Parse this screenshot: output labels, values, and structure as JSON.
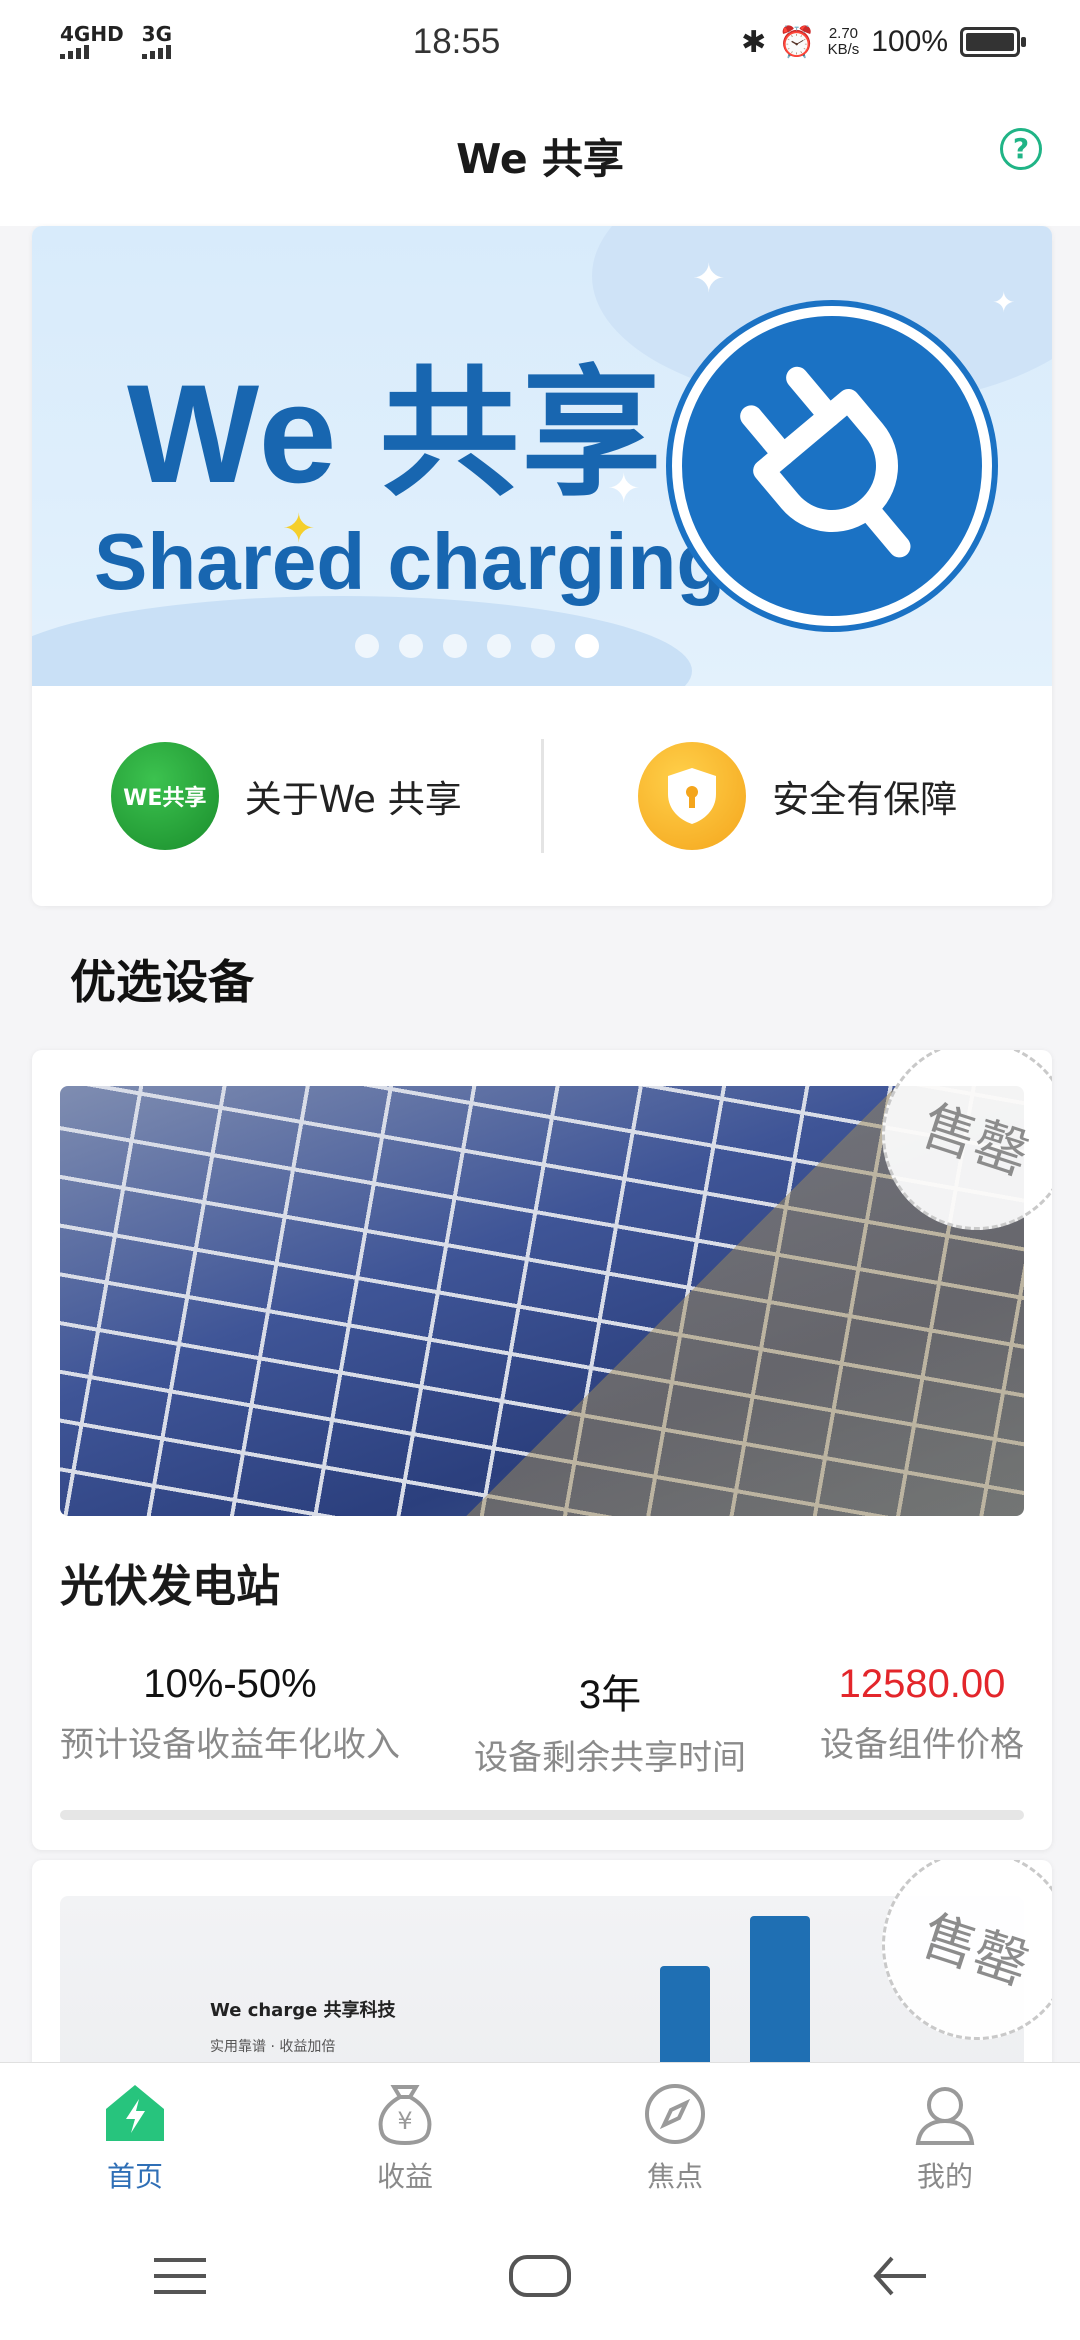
{
  "status_bar": {
    "network1": "4GHD",
    "network2": "3G",
    "time": "18:55",
    "net_speed_value": "2.70",
    "net_speed_unit": "KB/s",
    "battery": "100%"
  },
  "header": {
    "title": "We 共享"
  },
  "banner": {
    "title": "We 共享",
    "subtitle": "Shared charging",
    "slide_count": 6,
    "active_slide": 6
  },
  "quick_links": [
    {
      "label": "关于We 共享",
      "icon": "we-share-logo-icon",
      "icon_text": "WE共享"
    },
    {
      "label": "安全有保障",
      "icon": "shield-icon"
    }
  ],
  "section": {
    "title": "优选设备"
  },
  "products": [
    {
      "title": "光伏发电站",
      "badge": "售罄",
      "stats": [
        {
          "value": "10%-50%",
          "label": "预计设备收益年化收入"
        },
        {
          "value": "3年",
          "label": "设备剩余共享时间"
        },
        {
          "value": "12580.00",
          "label": "设备组件价格"
        }
      ],
      "progress": 0
    },
    {
      "badge": "售罄",
      "image_text_brand": "We charge 共享科技",
      "image_text_sub": "实用靠谱 · 收益加倍"
    }
  ],
  "tabs": [
    {
      "label": "首页",
      "icon": "home-lightning-icon",
      "active": true
    },
    {
      "label": "收益",
      "icon": "money-bag-icon",
      "active": false
    },
    {
      "label": "焦点",
      "icon": "compass-icon",
      "active": false
    },
    {
      "label": "我的",
      "icon": "user-icon",
      "active": false
    }
  ],
  "colors": {
    "accent": "#2f6fb6",
    "brand_green": "#20b486",
    "price_red": "#e3262b",
    "banner_blue": "#1866b0"
  }
}
